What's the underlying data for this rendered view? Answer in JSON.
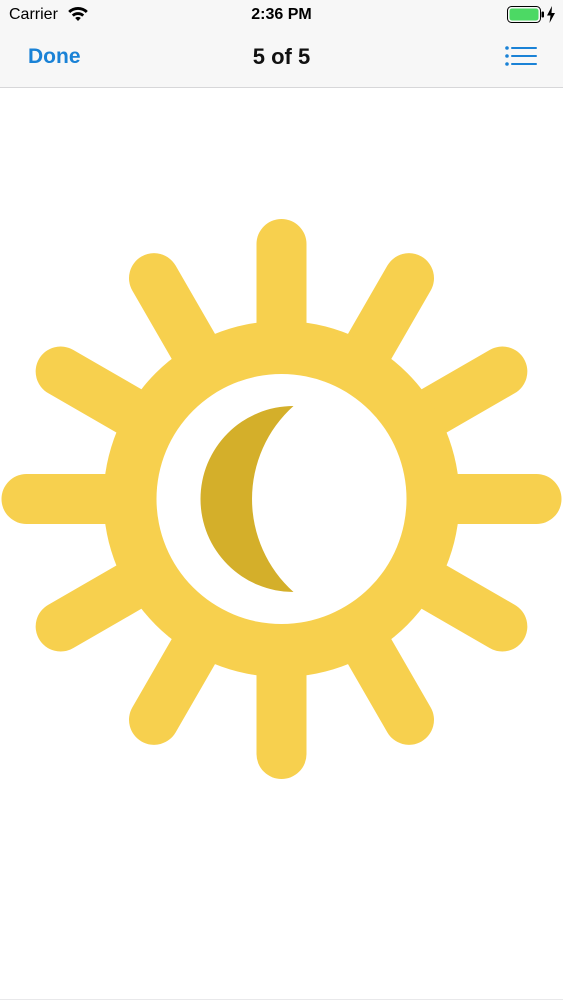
{
  "status_bar": {
    "carrier": "Carrier",
    "time": "2:36 PM",
    "battery_color": "#4cd964"
  },
  "nav": {
    "done_label": "Done",
    "title": "5 of 5",
    "list_icon": "list-icon",
    "accent_color": "#1a82d6"
  },
  "image": {
    "icon": "sun-moon-icon",
    "sun_color": "#f7d04e",
    "moon_color": "#d4af2a"
  }
}
